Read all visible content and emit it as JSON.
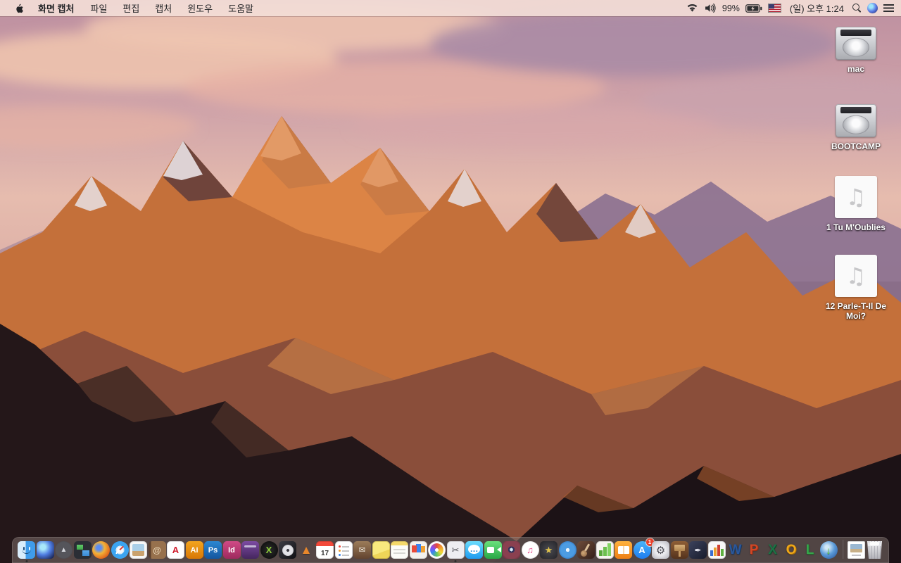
{
  "menu_bar": {
    "apple_menu": "apple",
    "app_name": "화면 캡처",
    "menus": [
      "파일",
      "편집",
      "캡처",
      "윈도우",
      "도움말"
    ],
    "status": {
      "wifi": "wifi-full",
      "volume": "volume-on",
      "battery_percent": "99%",
      "battery_state": "charging",
      "input_source_flag": "us-flag",
      "clock": "(일) 오후 1:24",
      "spotlight": "magnifier",
      "siri": "siri-orb",
      "notification_center": "list-lines"
    }
  },
  "desktop": {
    "icons": [
      {
        "name": "mac",
        "type": "drive",
        "label": "mac"
      },
      {
        "name": "bootcamp",
        "type": "drive",
        "label": "BOOTCAMP"
      },
      {
        "name": "tu-moublies",
        "type": "audio",
        "label": "1 Tu M'Oublies"
      },
      {
        "name": "parle-t-il-de-moi",
        "type": "audio",
        "label": "12 Parle-T-Il De Moi?"
      }
    ]
  },
  "dock": {
    "apps": [
      {
        "name": "finder",
        "icon": "finder",
        "glyph": "",
        "running": true
      },
      {
        "name": "siri",
        "icon": "siri",
        "glyph": ""
      },
      {
        "name": "launchpad",
        "icon": "launchpad",
        "glyph": "▲"
      },
      {
        "name": "mission-control",
        "icon": "mission",
        "glyph": ""
      },
      {
        "name": "firefox",
        "icon": "firefox",
        "glyph": ""
      },
      {
        "name": "safari",
        "icon": "safari",
        "glyph": ""
      },
      {
        "name": "preview",
        "icon": "preview",
        "glyph": ""
      },
      {
        "name": "contacts",
        "icon": "contacts",
        "glyph": "@"
      },
      {
        "name": "acrobat-reader",
        "icon": "acrobat",
        "glyph": "A"
      },
      {
        "name": "illustrator",
        "icon": "illustrator",
        "glyph": "Ai"
      },
      {
        "name": "photoshop",
        "icon": "photoshop",
        "glyph": "Ps"
      },
      {
        "name": "indesign",
        "icon": "indesign",
        "glyph": "Id"
      },
      {
        "name": "toast",
        "icon": "toast",
        "glyph": ""
      },
      {
        "name": "x-media-app",
        "icon": "xmedia",
        "glyph": "X"
      },
      {
        "name": "disc-tool-app",
        "icon": "disctool",
        "glyph": ""
      },
      {
        "name": "vlc",
        "icon": "vlc",
        "glyph": "▲"
      },
      {
        "name": "calendar",
        "icon": "calendar",
        "glyph": "17"
      },
      {
        "name": "reminders",
        "icon": "reminders",
        "glyph": ""
      },
      {
        "name": "archive-box-app",
        "icon": "archivebox",
        "glyph": "✉"
      },
      {
        "name": "stickies",
        "icon": "stickies",
        "glyph": ""
      },
      {
        "name": "notes",
        "icon": "notes",
        "glyph": ""
      },
      {
        "name": "documents-app",
        "icon": "docsapp",
        "glyph": ""
      },
      {
        "name": "photos",
        "icon": "photos",
        "glyph": ""
      },
      {
        "name": "screen-capture",
        "icon": "grab",
        "glyph": "✂",
        "running": true
      },
      {
        "name": "messages",
        "icon": "messages",
        "glyph": "…"
      },
      {
        "name": "facetime",
        "icon": "facetime",
        "glyph": ""
      },
      {
        "name": "photo-booth",
        "icon": "photobooth",
        "glyph": ""
      },
      {
        "name": "itunes",
        "icon": "itunes",
        "glyph": "♫"
      },
      {
        "name": "imovie",
        "icon": "imovie",
        "glyph": "★"
      },
      {
        "name": "idvd",
        "icon": "idvd",
        "glyph": ""
      },
      {
        "name": "garageband",
        "icon": "garageband",
        "glyph": ""
      },
      {
        "name": "numbers",
        "icon": "numbers09",
        "glyph": ""
      },
      {
        "name": "ibooks",
        "icon": "ibooks",
        "glyph": ""
      },
      {
        "name": "app-store",
        "icon": "appstore",
        "glyph": "A",
        "badge": "1"
      },
      {
        "name": "system-preferences",
        "icon": "sysprefs",
        "glyph": "⚙"
      },
      {
        "name": "keynote",
        "icon": "keynote09",
        "glyph": ""
      },
      {
        "name": "pages",
        "icon": "pages09",
        "glyph": "✒"
      },
      {
        "name": "office-chart-app",
        "icon": "officechart",
        "glyph": ""
      },
      {
        "name": "word",
        "icon": "word",
        "glyph": "W",
        "letter": true
      },
      {
        "name": "powerpoint",
        "icon": "powerpoint",
        "glyph": "P",
        "letter": true
      },
      {
        "name": "excel",
        "icon": "excel",
        "glyph": "X",
        "letter": true
      },
      {
        "name": "outlook",
        "icon": "outlook",
        "glyph": "O",
        "letter": true
      },
      {
        "name": "lync",
        "icon": "lync",
        "glyph": "L",
        "letter": true
      },
      {
        "name": "autoupdate-globe",
        "icon": "mau",
        "glyph": "↓"
      }
    ],
    "right": [
      {
        "name": "documents-stack",
        "icon": "stackdoc",
        "glyph": ""
      },
      {
        "name": "trash-full",
        "icon": "trash",
        "glyph": ""
      }
    ]
  },
  "colors": {
    "menubar_bg": "#f2ddd6",
    "dock_bg": "rgba(126,111,107,0.55)",
    "badge_red": "#e8402a",
    "label_text": "#ffffff"
  }
}
